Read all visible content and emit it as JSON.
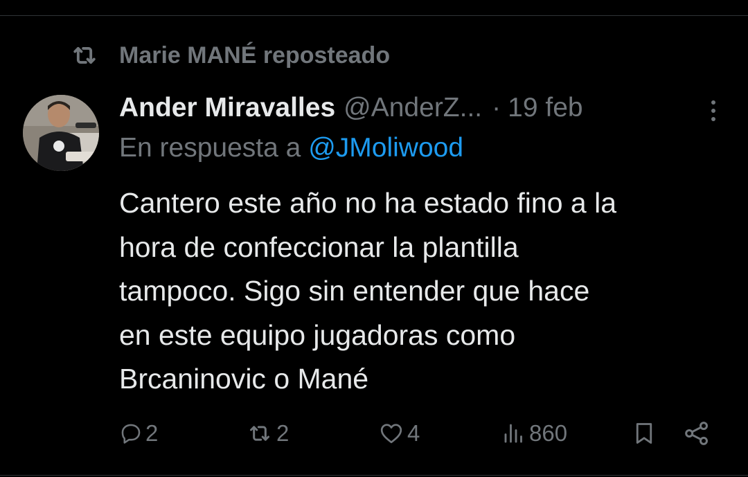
{
  "repost": {
    "text": "Marie MANÉ reposteado"
  },
  "tweet": {
    "author_name": "Ander Miravalles",
    "handle": "@AnderZ...",
    "separator": "·",
    "date": "19 feb",
    "reply_prefix": "En respuesta a",
    "reply_mention": "@JMoliwood",
    "text_lines": [
      "Cantero este año no ha estado fino a la",
      "hora de confeccionar la plantilla",
      "tampoco. Sigo sin entender que hace",
      "en este equipo jugadoras como",
      "Brcaninovic o Mané"
    ]
  },
  "actions": {
    "replies": "2",
    "reposts": "2",
    "likes": "4",
    "views": "860"
  },
  "colors": {
    "background": "#000000",
    "text_primary": "#e7e9ea",
    "text_secondary": "#71767b",
    "accent": "#1d9bf0",
    "divider": "#2f3336"
  },
  "icons": {
    "repost_header": "repost-icon",
    "more": "more-dots-icon",
    "reply": "reply-bubble-icon",
    "repost": "repost-icon",
    "like": "heart-icon",
    "views": "bar-chart-icon",
    "bookmark": "bookmark-icon",
    "share": "share-icon"
  }
}
